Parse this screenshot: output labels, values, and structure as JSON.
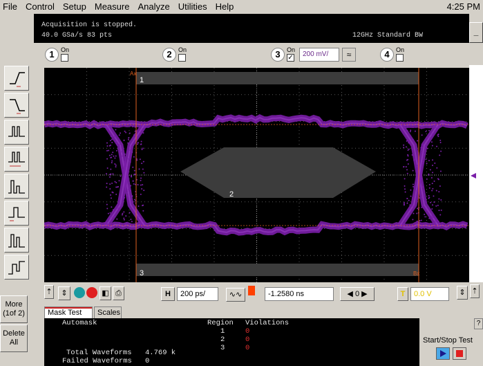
{
  "menu": [
    "File",
    "Control",
    "Setup",
    "Measure",
    "Analyze",
    "Utilities",
    "Help"
  ],
  "clock": "4:25 PM",
  "status": {
    "line1": "Acquisition is stopped.",
    "line2": "40.0 GSa/s   83 pts",
    "bandwidth": "12GHz Standard BW",
    "minimize": "_"
  },
  "channels": [
    {
      "num": "1",
      "on": "On",
      "checked": "",
      "color": "#c8a000"
    },
    {
      "num": "2",
      "on": "On",
      "checked": "",
      "color": "#2a9a2a"
    },
    {
      "num": "3",
      "on": "On",
      "checked": "✓",
      "color": "#6a2a8a",
      "scale": "200 mV/"
    },
    {
      "num": "4",
      "on": "On",
      "checked": "",
      "color": "#cc2288"
    }
  ],
  "sidebar": {
    "more": "More\n(1of 2)",
    "delete": "Delete\nAll"
  },
  "scope": {
    "region1_label": "1",
    "region2_label": "2",
    "region3_label": "3",
    "marker_a": "Ax",
    "marker_b": "Bx",
    "trace_color": "#7a1ea8",
    "mask_color": "#3c3c3c",
    "marker_color": "#e06020"
  },
  "controls": {
    "h_label": "H",
    "timebase": "200 ps/",
    "position": "-1.2580 ns",
    "trigger_label": "T",
    "trigger_level": "0.0 V",
    "play": "◀ 0 ▶"
  },
  "tabs": {
    "mask_test": "Mask Test",
    "scales": "Scales"
  },
  "results": {
    "automask": "Automask",
    "region_header": "Region",
    "violations_header": "Violations",
    "rows": [
      {
        "region": "1",
        "violations": "0"
      },
      {
        "region": "2",
        "violations": "0"
      },
      {
        "region": "3",
        "violations": "0"
      }
    ],
    "total_label": "Total Waveforms",
    "total_value": "4.769 k",
    "failed_label": "Failed Waveforms",
    "failed_value": "0"
  },
  "startstop": {
    "label": "Start/Stop Test",
    "help": "?"
  }
}
